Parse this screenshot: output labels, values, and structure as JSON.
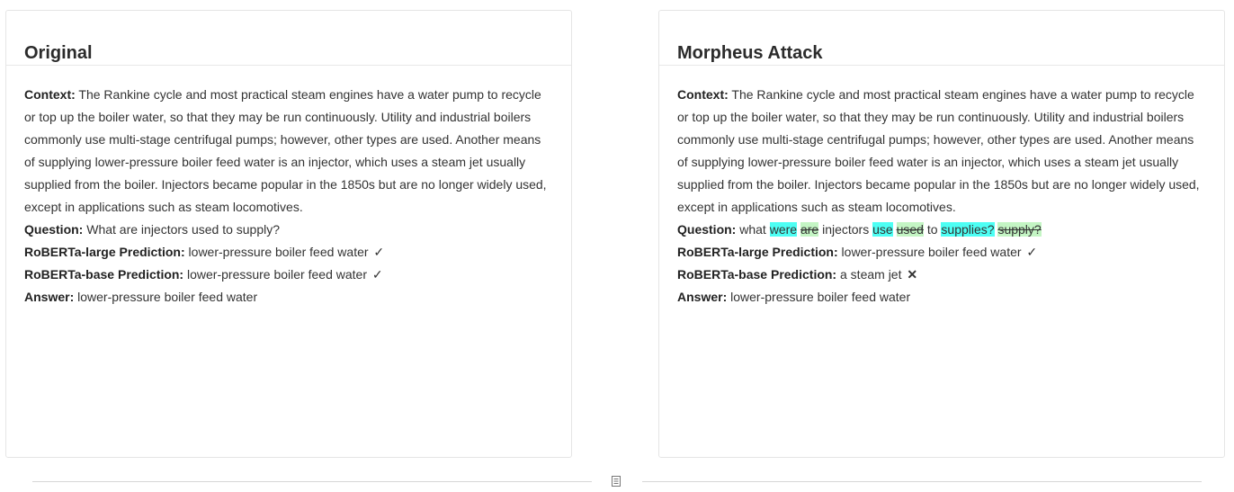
{
  "left": {
    "title": "Original",
    "context_label": "Context:",
    "context_text": "The Rankine cycle and most practical steam engines have a water pump to recycle or top up the boiler water, so that they may be run continuously. Utility and industrial boilers commonly use multi-stage centrifugal pumps; however, other types are used. Another means of supplying lower-pressure boiler feed water is an injector, which uses a steam jet usually supplied from the boiler. Injectors became popular in the 1850s but are no longer widely used, except in applications such as steam locomotives.",
    "question_label": "Question:",
    "question_text": "What are injectors used to supply?",
    "large_label": "RoBERTa-large Prediction:",
    "large_text": "lower-pressure boiler feed water",
    "large_mark": "✓",
    "base_label": "RoBERTa-base Prediction:",
    "base_text": "lower-pressure boiler feed water",
    "base_mark": "✓",
    "answer_label": "Answer:",
    "answer_text": "lower-pressure boiler feed water"
  },
  "right": {
    "title": "Morpheus Attack",
    "context_label": "Context:",
    "context_text": "The Rankine cycle and most practical steam engines have a water pump to recycle or top up the boiler water, so that they may be run continuously. Utility and industrial boilers commonly use multi-stage centrifugal pumps; however, other types are used. Another means of supplying lower-pressure boiler feed water is an injector, which uses a steam jet usually supplied from the boiler. Injectors became popular in the 1850s but are no longer widely used, except in applications such as steam locomotives.",
    "question_label": "Question:",
    "q_w1": "what",
    "q_new1": "were",
    "q_old1": "are",
    "q_w2": "injectors",
    "q_new2": "use",
    "q_old2": "used",
    "q_w3": "to",
    "q_new3": "supplies?",
    "q_old3": "supply?",
    "large_label": "RoBERTa-large Prediction:",
    "large_text": "lower-pressure boiler feed water",
    "large_mark": "✓",
    "base_label": "RoBERTa-base Prediction:",
    "base_text": "a steam jet",
    "base_mark": "✕",
    "answer_label": "Answer:",
    "answer_text": "lower-pressure boiler feed water"
  },
  "colors": {
    "highlight_new": "#4dfff4",
    "highlight_old": "#c4f5c4"
  },
  "footer": {
    "icon": "document-icon"
  }
}
